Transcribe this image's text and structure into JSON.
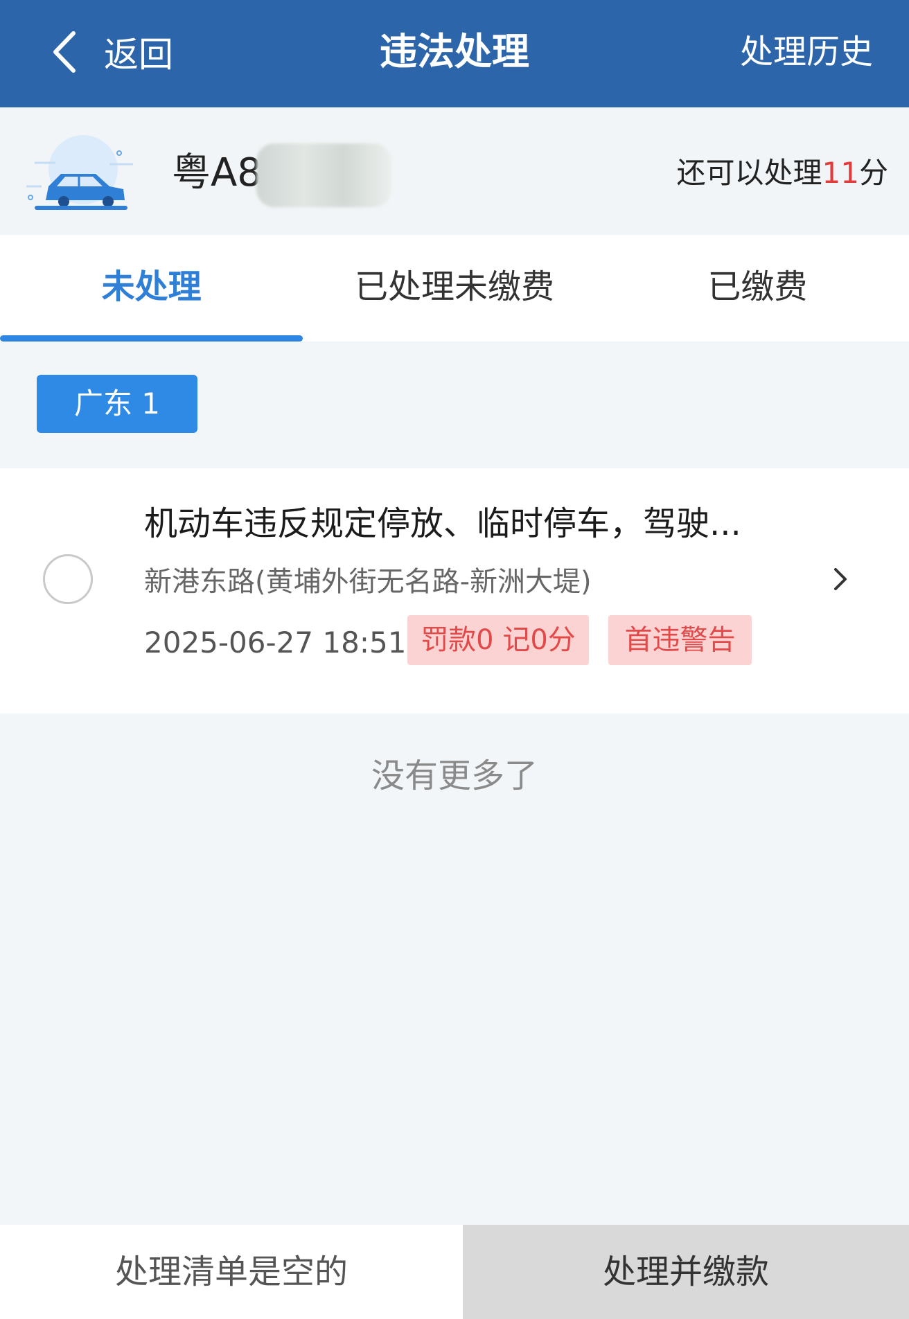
{
  "header": {
    "back_label": "返回",
    "title": "违法处理",
    "history_label": "处理历史",
    "background_color": "#2c65a9"
  },
  "vehicle": {
    "icon": "car-icon",
    "plate_visible": "粤A8",
    "remaining_prefix": "还可以处理",
    "remaining_points": "11",
    "remaining_suffix": "分"
  },
  "tabs": [
    {
      "label": "未处理",
      "active": true
    },
    {
      "label": "已处理未缴费",
      "active": false
    },
    {
      "label": "已缴费",
      "active": false
    }
  ],
  "region_chip": "广东 1",
  "violations": [
    {
      "title": "机动车违反规定停放、临时停车，驾驶...",
      "location": "新港东路(黄埔外街无名路-新洲大堤)",
      "time": "2025-06-27 18:51",
      "fine_tag": "罚款0 记0分",
      "warning_tag": "首违警告"
    }
  ],
  "no_more_text": "没有更多了",
  "bottom": {
    "list_status": "处理清单是空的",
    "action_button": "处理并缴款"
  },
  "colors": {
    "accent": "#2f85e2",
    "points_red": "#e23b3b",
    "tag_bg": "#fbd3d3"
  }
}
